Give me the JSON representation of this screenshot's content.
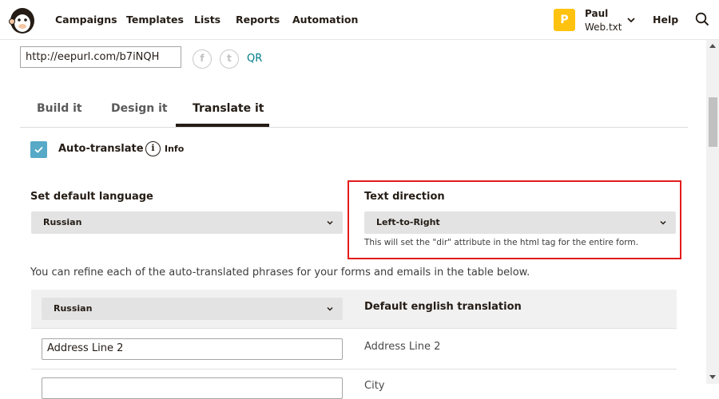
{
  "nav": {
    "items": [
      "Campaigns",
      "Templates",
      "Lists",
      "Reports",
      "Automation"
    ],
    "user": {
      "initial": "P",
      "name": "Paul",
      "org": "Web.txt"
    },
    "help": "Help"
  },
  "signup": {
    "url": "http://eepurl.com/b7iNQH",
    "social": [
      {
        "icon": "facebook-icon",
        "glyph": "f"
      },
      {
        "icon": "twitter-icon",
        "glyph": "t"
      }
    ],
    "qr_label": "QR"
  },
  "tabs": [
    {
      "label": "Build it",
      "active": false
    },
    {
      "label": "Design it",
      "active": false
    },
    {
      "label": "Translate it",
      "active": true
    }
  ],
  "auto_translate": {
    "label": "Auto-translate",
    "checked": true,
    "info_glyph": "i",
    "info_label": "Info"
  },
  "default_language": {
    "label": "Set default language",
    "value": "Russian"
  },
  "text_direction": {
    "label": "Text direction",
    "value": "Left-to-Right",
    "helper": "This will set the \"dir\" attribute in the html tag for the entire form."
  },
  "refine_text": "You can refine each of the auto-translated phrases for your forms and emails in the table below.",
  "table": {
    "language_select": "Russian",
    "column_header": "Default english translation",
    "rows": [
      {
        "input": "Address Line 2",
        "default": "Address Line 2"
      },
      {
        "input": "",
        "default": "City"
      }
    ]
  },
  "colors": {
    "accent": "#007c89",
    "checkbox": "#56a9c7",
    "avatar": "#ffc20e",
    "highlight": "#e21b1b"
  }
}
